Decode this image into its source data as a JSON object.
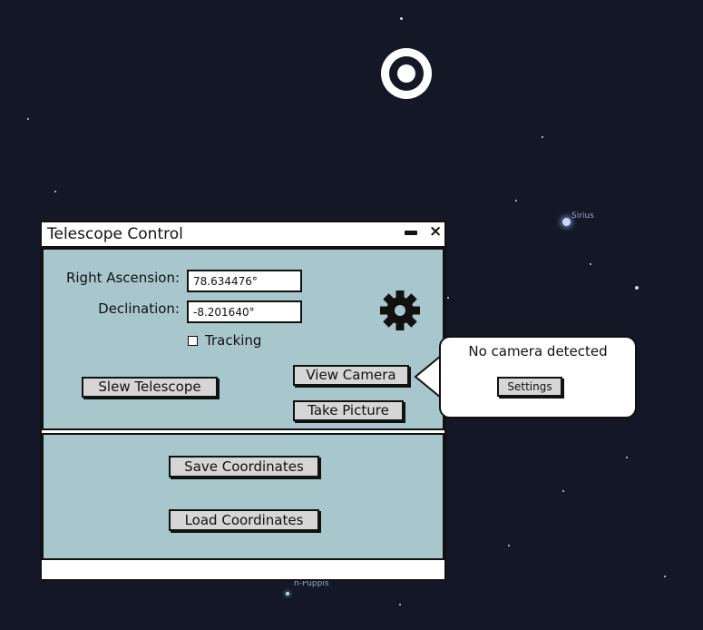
{
  "sky": {
    "star_labels": [
      "Sirius",
      "n-Puppis"
    ]
  },
  "window": {
    "title": "Telescope Control",
    "minimize_glyph": "",
    "close_glyph": "×",
    "icons": [
      "minimize-icon",
      "close-icon",
      "gear-icon",
      "checkbox-icon"
    ],
    "right_ascension": {
      "label": "Right Ascension:",
      "value": "78.634476°"
    },
    "declination": {
      "label": "Declination:",
      "value": "-8.201640°"
    },
    "tracking": {
      "label": "Tracking",
      "checked": false
    },
    "buttons": {
      "slew": "Slew Telescope",
      "view_camera": "View Camera",
      "take_picture": "Take Picture",
      "save_coordinates": "Save Coordinates",
      "load_coordinates": "Load Coordinates"
    },
    "status_text": ""
  },
  "popup": {
    "message": "No camera detected",
    "settings_button": "Settings"
  },
  "colors": {
    "sky": "#141826",
    "panel": "#a8c7cc",
    "button": "#d6d6d6",
    "border": "#111111"
  }
}
